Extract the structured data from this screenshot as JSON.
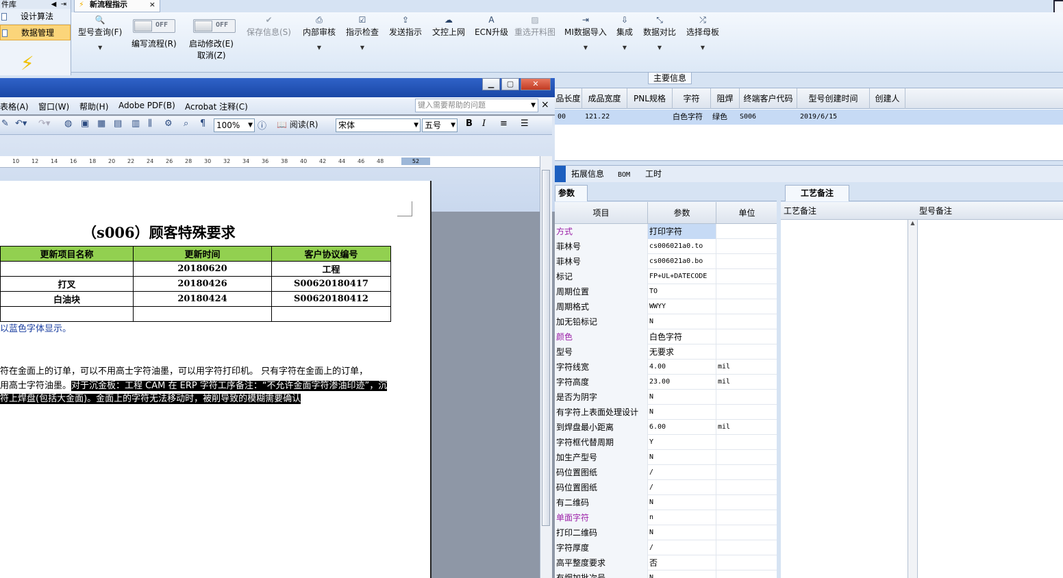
{
  "leftnav": {
    "header": "件库",
    "items": [
      {
        "label": "设计算法"
      },
      {
        "label": "数据管理"
      }
    ]
  },
  "tab": {
    "title": "新流程指示",
    "close": "×"
  },
  "ribbon": {
    "buttons": [
      {
        "label": "型号查询(F)",
        "icon": "search-icon"
      },
      {
        "label": "保存信息(S)",
        "icon": "check-icon"
      },
      {
        "label": "内部审核",
        "icon": "printer-icon"
      },
      {
        "label": "指示检查",
        "icon": "checklist-icon"
      },
      {
        "label": "发送指示",
        "icon": "upload-icon"
      },
      {
        "label": "文控上网",
        "icon": "cloud-icon"
      },
      {
        "label": "ECN升级",
        "icon": "font-icon"
      },
      {
        "label": "重选开料图",
        "icon": "image-icon"
      },
      {
        "label": "MI数据导入",
        "icon": "import-icon"
      },
      {
        "label": "集成",
        "icon": "download-icon"
      },
      {
        "label": "数据对比",
        "icon": "compare-icon"
      },
      {
        "label": "选择母板",
        "icon": "shuffle-icon"
      }
    ],
    "toggles": [
      {
        "label": "编写流程(R)",
        "state": "OFF"
      },
      {
        "label": "启动修改(E)",
        "sublabel": "取消(Z)",
        "state": "OFF"
      }
    ]
  },
  "info": {
    "section_label": "主要信息",
    "columns": [
      "品长度",
      "成品宽度",
      "PNL规格",
      "字符",
      "阻焊",
      "终端客户代码",
      "型号创建时间",
      "创建人"
    ],
    "row": [
      "00",
      "121.22",
      "",
      "白色字符",
      "绿色",
      "S006",
      "2019/6/15",
      ""
    ]
  },
  "subtabs": [
    "拓展信息",
    "BOM",
    "工时"
  ],
  "params": {
    "tab": "参数",
    "headers": [
      "项目",
      "参数",
      "单位"
    ],
    "rows": [
      {
        "name": "方式",
        "value": "打印字符",
        "unit": "",
        "purple": true,
        "selected": true
      },
      {
        "name": "菲林号",
        "value": "cs006021a0.to",
        "unit": "",
        "mono": true
      },
      {
        "name": "菲林号",
        "value": "cs006021a0.bo",
        "unit": "",
        "mono": true
      },
      {
        "name": "标记",
        "value": "FP+UL+DATECODE",
        "unit": "",
        "mono": true
      },
      {
        "name": "周期位置",
        "value": "TO",
        "unit": "",
        "mono": true
      },
      {
        "name": "周期格式",
        "value": "WWYY",
        "unit": "",
        "mono": true
      },
      {
        "name": "加无铅标记",
        "value": "N",
        "unit": "",
        "mono": true
      },
      {
        "name": "颜色",
        "value": "白色字符",
        "unit": "",
        "purple": true
      },
      {
        "name": "型号",
        "value": "无要求",
        "unit": ""
      },
      {
        "name": "字符线宽",
        "value": "4.00",
        "unit": "mil",
        "mono": true
      },
      {
        "name": "字符高度",
        "value": "23.00",
        "unit": "mil",
        "mono": true
      },
      {
        "name": "是否为阴字",
        "value": "N",
        "unit": "",
        "mono": true
      },
      {
        "name": "有字符上表面处理设计",
        "value": "N",
        "unit": "",
        "mono": true
      },
      {
        "name": "到焊盘最小距离",
        "value": "6.00",
        "unit": "mil",
        "mono": true
      },
      {
        "name": "字符框代替周期",
        "value": "Y",
        "unit": "",
        "mono": true
      },
      {
        "name": "加生产型号",
        "value": "N",
        "unit": "",
        "mono": true
      },
      {
        "name": "码位置图纸",
        "value": "/",
        "unit": "",
        "mono": true
      },
      {
        "name": "码位置图纸",
        "value": "/",
        "unit": "",
        "mono": true
      },
      {
        "name": "有二维码",
        "value": "N",
        "unit": "",
        "mono": true
      },
      {
        "name": "单面字符",
        "value": "n",
        "unit": "",
        "purple": true,
        "mono": true
      },
      {
        "name": "打印二维码",
        "value": "N",
        "unit": "",
        "mono": true
      },
      {
        "name": "字符厚度",
        "value": "/",
        "unit": "",
        "mono": true
      },
      {
        "name": "高平整度要求",
        "value": "否",
        "unit": ""
      },
      {
        "name": "有烟加批次号",
        "value": "N",
        "unit": "",
        "mono": true
      }
    ]
  },
  "notes": {
    "tab": "工艺备注",
    "headers": [
      "工艺备注",
      "型号备注"
    ]
  },
  "word": {
    "menu": [
      "表格(A)",
      "窗口(W)",
      "帮助(H)",
      "Adobe PDF(B)",
      "Acrobat 注释(C)"
    ],
    "search_placeholder": "键入需要帮助的问题",
    "close": "×",
    "zoom": "100%",
    "read_label": "阅读(R)",
    "font": "宋体",
    "size": "五号",
    "ruler": [
      "10",
      "12",
      "14",
      "16",
      "18",
      "20",
      "22",
      "24",
      "26",
      "28",
      "30",
      "32",
      "34",
      "36",
      "38",
      "40",
      "42",
      "44",
      "46",
      "48",
      "52"
    ],
    "title": "（s006）顾客特殊要求",
    "table": {
      "headers": [
        "更新项目名称",
        "更新时间",
        "客户协议编号"
      ],
      "rows": [
        [
          "",
          "20180620",
          "工程"
        ],
        [
          "打叉",
          "20180426",
          "S00620180417"
        ],
        [
          "白油块",
          "20180424",
          "S00620180412"
        ],
        [
          "",
          "",
          ""
        ]
      ]
    },
    "para_blue": "以蓝色字体显示。",
    "para1": "符在金面上的订单，可以不用高士字符油墨，可以用字符打印机。   只有字符在金面上的订单，",
    "para2_a": "用高士字符油墨。",
    "para2_b": "对于沉金板：工程 CAM 在 ERP 字符工序备注：“不允许金面字符渗油印迹”，沉",
    "para3": "符上焊盘(包括大金面)。金面上的字符无法移动时，被削导致的模糊需要确认"
  }
}
